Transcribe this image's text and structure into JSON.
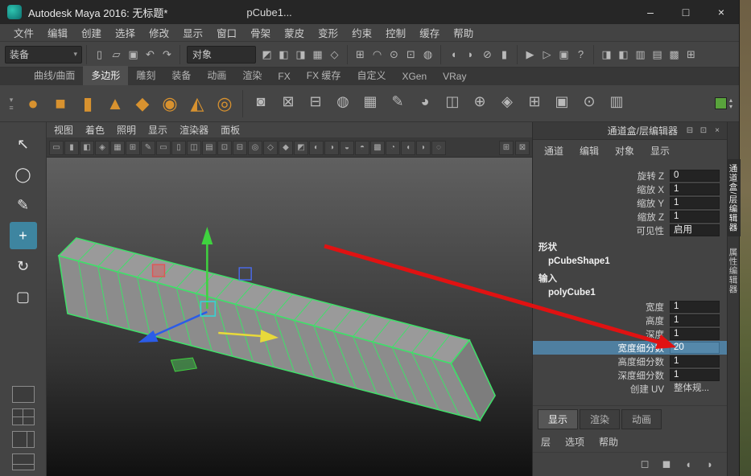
{
  "titlebar": {
    "title": "Autodesk Maya 2016: 无标题*",
    "doc_tab": "pCube1...",
    "controls": [
      {
        "name": "minimize-button",
        "glyph": "–"
      },
      {
        "name": "maximize-button",
        "glyph": "□"
      },
      {
        "name": "close-button",
        "glyph": "×"
      }
    ]
  },
  "menubar": {
    "items": [
      "文件",
      "编辑",
      "创建",
      "选择",
      "修改",
      "显示",
      "窗口",
      "骨架",
      "蒙皮",
      "变形",
      "约束",
      "控制",
      "缓存",
      "帮助"
    ]
  },
  "statusline": {
    "menuset_label": "装备",
    "menuset_arrow": "▾",
    "object_label": "对象",
    "file_icons": [
      {
        "name": "new-scene-icon",
        "glyph": "▯"
      },
      {
        "name": "open-scene-icon",
        "glyph": "▱"
      },
      {
        "name": "save-scene-icon",
        "glyph": "▣"
      },
      {
        "name": "undo-icon",
        "glyph": "↶"
      },
      {
        "name": "redo-icon",
        "glyph": "↷"
      }
    ],
    "mask_icons": [
      {
        "name": "select-hierarchy-icon",
        "glyph": "◩"
      },
      {
        "name": "select-object-icon",
        "glyph": "◧"
      },
      {
        "name": "select-component-icon",
        "glyph": "◨"
      },
      {
        "name": "select-all-mask-icon",
        "glyph": "▦"
      },
      {
        "name": "select-handles-icon",
        "glyph": "◇"
      }
    ],
    "snap_icons": [
      {
        "name": "snap-grid-icon",
        "glyph": "⊞"
      },
      {
        "name": "snap-curve-icon",
        "glyph": "◠"
      },
      {
        "name": "snap-point-icon",
        "glyph": "⊙"
      },
      {
        "name": "snap-plane-icon",
        "glyph": "⊡"
      },
      {
        "name": "make-live-icon",
        "glyph": "◍"
      }
    ],
    "history_icons": [
      {
        "name": "input-connections-icon",
        "glyph": "◖"
      },
      {
        "name": "output-connections-icon",
        "glyph": "◗"
      },
      {
        "name": "construction-history-icon",
        "glyph": "⊘"
      },
      {
        "name": "lock-icon",
        "glyph": "▮"
      }
    ],
    "render_icons": [
      {
        "name": "render-icon",
        "glyph": "▶"
      },
      {
        "name": "ipr-render-icon",
        "glyph": "▷"
      },
      {
        "name": "render-settings-icon",
        "glyph": "▣"
      },
      {
        "name": "help-line-icon",
        "glyph": "?"
      }
    ],
    "sidebar_icons": [
      {
        "name": "attribute-editor-toggle-icon",
        "glyph": "◨"
      },
      {
        "name": "tool-settings-toggle-icon",
        "glyph": "◧"
      },
      {
        "name": "channel-box-toggle-icon",
        "glyph": "▥"
      },
      {
        "name": "modeling-toolkit-toggle-icon",
        "glyph": "▤"
      },
      {
        "name": "outliner-toggle-icon",
        "glyph": "▩"
      },
      {
        "name": "workspace-icon",
        "glyph": "⊞"
      }
    ]
  },
  "shelf": {
    "menu_glyphs": {
      "arrow": "▾",
      "list": "≡"
    },
    "tabs": [
      {
        "label": "曲线/曲面"
      },
      {
        "label": "多边形"
      },
      {
        "label": "雕刻"
      },
      {
        "label": "装备"
      },
      {
        "label": "动画"
      },
      {
        "label": "渲染"
      },
      {
        "label": "FX"
      },
      {
        "label": "FX 缓存"
      },
      {
        "label": "自定义"
      },
      {
        "label": "XGen"
      },
      {
        "label": "VRay"
      }
    ],
    "primitive_icons": [
      {
        "name": "polygon-sphere-icon",
        "glyph": "●"
      },
      {
        "name": "polygon-cube-icon",
        "glyph": "■"
      },
      {
        "name": "polygon-cylinder-icon",
        "glyph": "▮"
      },
      {
        "name": "polygon-cone-icon",
        "glyph": "▲"
      },
      {
        "name": "polygon-torus-icon",
        "glyph": "◆"
      },
      {
        "name": "polygon-plane-icon",
        "glyph": "◉"
      },
      {
        "name": "polygon-pyramid-icon",
        "glyph": "◭"
      },
      {
        "name": "polygon-pipe-icon",
        "glyph": "◎"
      }
    ],
    "tool_icons": [
      {
        "name": "boolean-union-icon",
        "glyph": "◙"
      },
      {
        "name": "combine-icon",
        "glyph": "⊠"
      },
      {
        "name": "separate-icon",
        "glyph": "⊟"
      },
      {
        "name": "smooth-icon",
        "glyph": "◍"
      },
      {
        "name": "grid-mesh-icon",
        "glyph": "▦"
      },
      {
        "name": "multi-cut-icon",
        "glyph": "✎"
      },
      {
        "name": "sculpt-icon",
        "glyph": "◕"
      },
      {
        "name": "mirror-icon",
        "glyph": "◫"
      },
      {
        "name": "extrude-icon",
        "glyph": "⊕"
      },
      {
        "name": "bevel-icon",
        "glyph": "◈"
      },
      {
        "name": "bridge-icon",
        "glyph": "⊞"
      },
      {
        "name": "quad-draw-icon",
        "glyph": "▣"
      },
      {
        "name": "target-weld-icon",
        "glyph": "⊙"
      },
      {
        "name": "insert-edge-loop-icon",
        "glyph": "▥"
      }
    ]
  },
  "toolbox": {
    "tools": [
      {
        "name": "select-tool-icon",
        "glyph": "↖"
      },
      {
        "name": "lasso-tool-icon",
        "glyph": "◯"
      },
      {
        "name": "paint-select-tool-icon",
        "glyph": "✎"
      },
      {
        "name": "move-tool-icon",
        "glyph": "+"
      },
      {
        "name": "rotate-tool-icon",
        "glyph": "↻"
      },
      {
        "name": "scale-tool-icon",
        "glyph": "▢"
      }
    ]
  },
  "viewport": {
    "menus": [
      "视图",
      "着色",
      "照明",
      "显示",
      "渲染器",
      "面板"
    ],
    "subdivisions": 20,
    "toolbar_icons": [
      {
        "name": "select-camera-icon",
        "glyph": "▭"
      },
      {
        "name": "lock-camera-icon",
        "glyph": "▮"
      },
      {
        "name": "camera-attributes-icon",
        "glyph": "◧"
      },
      {
        "name": "bookmark-icon",
        "glyph": "◈"
      },
      {
        "name": "image-plane-icon",
        "glyph": "▦"
      },
      {
        "name": "2d-pan-zoom-icon",
        "glyph": "⊞"
      },
      {
        "name": "grease-pencil-icon",
        "glyph": "✎"
      },
      {
        "name": "film-gate-icon",
        "glyph": "▭"
      },
      {
        "name": "resolution-gate-icon",
        "glyph": "▯"
      },
      {
        "name": "gate-mask-icon",
        "glyph": "◫"
      },
      {
        "name": "field-chart-icon",
        "glyph": "▤"
      },
      {
        "name": "safe-action-icon",
        "glyph": "⊡"
      },
      {
        "name": "safe-title-icon",
        "glyph": "⊟"
      },
      {
        "name": "frame-all-icon",
        "glyph": "◎"
      },
      {
        "name": "wireframe-icon",
        "glyph": "◇"
      },
      {
        "name": "shaded-icon",
        "glyph": "◆"
      },
      {
        "name": "textured-icon",
        "glyph": "◩"
      },
      {
        "name": "use-all-lights-icon",
        "glyph": "◐"
      },
      {
        "name": "shadows-icon",
        "glyph": "◑"
      },
      {
        "name": "ssao-icon",
        "glyph": "◒"
      },
      {
        "name": "motion-blur-icon",
        "glyph": "◓"
      },
      {
        "name": "multisample-icon",
        "glyph": "▩"
      },
      {
        "name": "depth-of-field-icon",
        "glyph": "◔"
      },
      {
        "name": "isolate-select-icon",
        "glyph": "◖"
      },
      {
        "name": "xray-icon",
        "glyph": "◗"
      },
      {
        "name": "exposure-icon",
        "glyph": "◌"
      }
    ],
    "panel_icons": [
      {
        "name": "pane-maximize-icon",
        "glyph": "⊞"
      },
      {
        "name": "pane-tear-off-icon",
        "glyph": "⊠"
      }
    ]
  },
  "channelbox": {
    "title": "通道盒/层编辑器",
    "header_icons": [
      {
        "name": "collapse-panel-icon",
        "glyph": "⊟"
      },
      {
        "name": "popout-panel-icon",
        "glyph": "⊡"
      },
      {
        "name": "close-panel-icon",
        "glyph": "×"
      }
    ],
    "menus": [
      "通道",
      "编辑",
      "对象",
      "显示"
    ],
    "rows": [
      {
        "label": "旋转 Z",
        "value": "0"
      },
      {
        "label": "缩放 X",
        "value": "1"
      },
      {
        "label": "缩放 Y",
        "value": "1"
      },
      {
        "label": "缩放 Z",
        "value": "1"
      },
      {
        "label": "可见性",
        "value": "启用"
      },
      {
        "label": "形状"
      },
      {
        "label": "pCubeShape1"
      },
      {
        "label": "输入"
      },
      {
        "label": "polyCube1"
      },
      {
        "label": "宽度",
        "value": "1"
      },
      {
        "label": "高度",
        "value": "1"
      },
      {
        "label": "深度",
        "value": "1"
      },
      {
        "label": "宽度细分数",
        "value": "20"
      },
      {
        "label": "高度细分数",
        "value": "1"
      },
      {
        "label": "深度细分数",
        "value": "1"
      },
      {
        "label": "创建 UV",
        "value": "整体规..."
      }
    ]
  },
  "layer_editor": {
    "tabs": [
      "显示",
      "渲染",
      "动画"
    ],
    "menus": [
      "层",
      "选项",
      "帮助"
    ],
    "icons": [
      {
        "name": "new-empty-layer-icon",
        "glyph": "◻"
      },
      {
        "name": "new-layer-from-selected-icon",
        "glyph": "◼"
      },
      {
        "name": "layer-up-icon",
        "glyph": "◖"
      },
      {
        "name": "layer-down-icon",
        "glyph": "◗"
      }
    ]
  },
  "right_tabs": [
    {
      "label": "通道盒/层编辑器"
    },
    {
      "label": "属性编辑器"
    }
  ]
}
